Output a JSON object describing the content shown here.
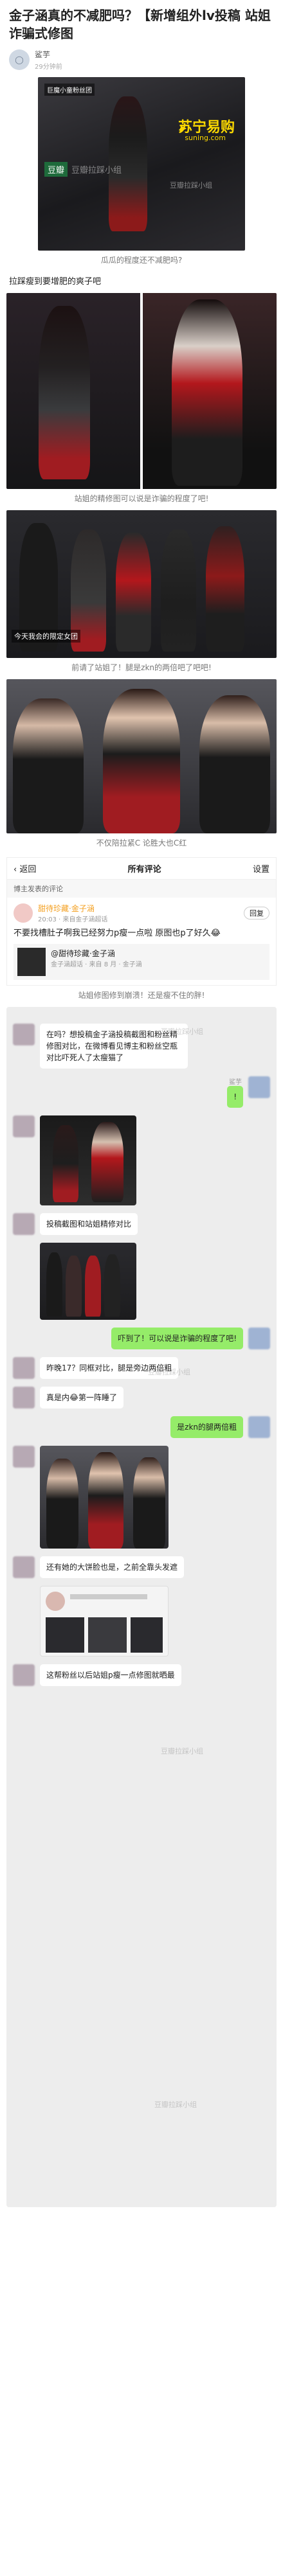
{
  "article": {
    "title": "金子涵真的不减肥吗？【新增组外lv投稿 站姐诈骗式修图",
    "author": "鲨芋",
    "date": "29分钟前"
  },
  "images": {
    "img1_tag": "巨魔小童粉丝团",
    "img1_wm1": "豆瓣",
    "img1_wm2": "豆瓣拉踩小组",
    "img1_wm3": "豆瓣拉踩小组",
    "img1_logo": "苏宁易购",
    "img1_logo_sub": "suning.com",
    "img1_cap": "瓜瓜的程度还不减肥吗?",
    "para1": "拉踩瘦到要增肥的爽子吧",
    "img2_cap": "站姐的精修图可以说是诈骗的程度了吧!",
    "img3_banner": "今天我会的限定女团",
    "img3_cap": "前请了站姐了！腿是zkn的两倍吧了吧吧!",
    "img4_cap": "不仅陪拉紧C 论胜大也C红"
  },
  "comment_panel": {
    "back": "返回",
    "tab": "所有评论",
    "settings": "设置",
    "op_label": "博主发表的评论",
    "commenter": "甜待珍藏·金子涵",
    "comment_meta": "20:03 · 来自金子涵超话",
    "reply_button": "回复",
    "comment_text": "不要找槽肚子啊我已经努力p瘦一点啦 原图也p了好久😂",
    "quote_name": "@甜待珍藏·金子涵",
    "quote_text": "金子涵超话 · 来自 8 月 · 金子涵",
    "caption": "站姐修图修到崩溃！还是瘦不住的胖!"
  },
  "chat": {
    "msg1": "在吗？想投稿金子涵投稿截图和粉丝精修图对比，在微博看见博主和粉丝空瓶对比吓死人了太瘦猫了",
    "msg2_name": "鲨芋",
    "msg2": "!",
    "msg3": "投稿截图和站姐精修对比",
    "msg4": "吓到了！可以说是诈骗的程度了吧!",
    "msg5": "昨晚17？同框对比，腿是旁边两倍粗",
    "msg6": "真是内😂第一阵睡了",
    "msg7": "是zkn的腿两倍粗",
    "msg8": "还有她的大饼脸也是，之前全靠头发遮",
    "msg9": "这帮粉丝以后站姐p瘦一点修图就晒最",
    "wm": "豆瓣拉踩小组"
  },
  "icons": {
    "back": "chevron-left-icon",
    "smile": "smile-icon"
  },
  "colors": {
    "red": "#c8161d",
    "green_bubble": "#95ec69",
    "chat_bg": "#ededed"
  }
}
